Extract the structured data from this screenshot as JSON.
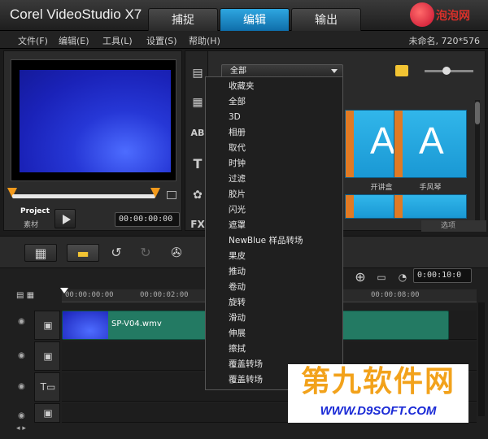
{
  "window": {
    "title": "Corel VideoStudio X7",
    "tabs": [
      "捕捉",
      "编辑",
      "输出"
    ],
    "active_tab": "编辑",
    "logo_text": "泡泡网"
  },
  "menu": {
    "items": [
      "文件(F)",
      "编辑(E)",
      "工具(L)",
      "设置(S)",
      "帮助(H)"
    ],
    "project_info": "未命名, 720*576"
  },
  "preview": {
    "project_label": "Project",
    "clip_label": "素材",
    "timecode": "00:00:00:00"
  },
  "library": {
    "category_selected": "全部",
    "side_icons": [
      "media-icon",
      "instant-project-icon",
      "transition-icon",
      "title-icon",
      "graphic-icon",
      "filter-icon"
    ],
    "side_icon_text": {
      "transition": "AB",
      "title": "T",
      "filter": "FX"
    },
    "thumbnails": [
      {
        "label": "开讲盒"
      },
      {
        "label": "手风琴"
      }
    ],
    "options_label": "选项"
  },
  "dropdown": {
    "items": [
      "收藏夹",
      "全部",
      "3D",
      "相册",
      "取代",
      "时钟",
      "过滤",
      "胶片",
      "闪光",
      "遮罩",
      "NewBlue 样品转场",
      "果皮",
      "推动",
      "卷动",
      "旋转",
      "滑动",
      "伸展",
      "擦拭",
      "覆盖转场",
      "覆盖转场"
    ]
  },
  "timeline": {
    "timecode": "0:00:10:0",
    "ruler": [
      "00:00:00:00",
      "00:00:02:00",
      "00:00:08:00"
    ],
    "clip_name": "SP-V04.wmv"
  },
  "watermark": {
    "brand": "第九软件网",
    "url": "WWW.D9SOFT.COM"
  }
}
